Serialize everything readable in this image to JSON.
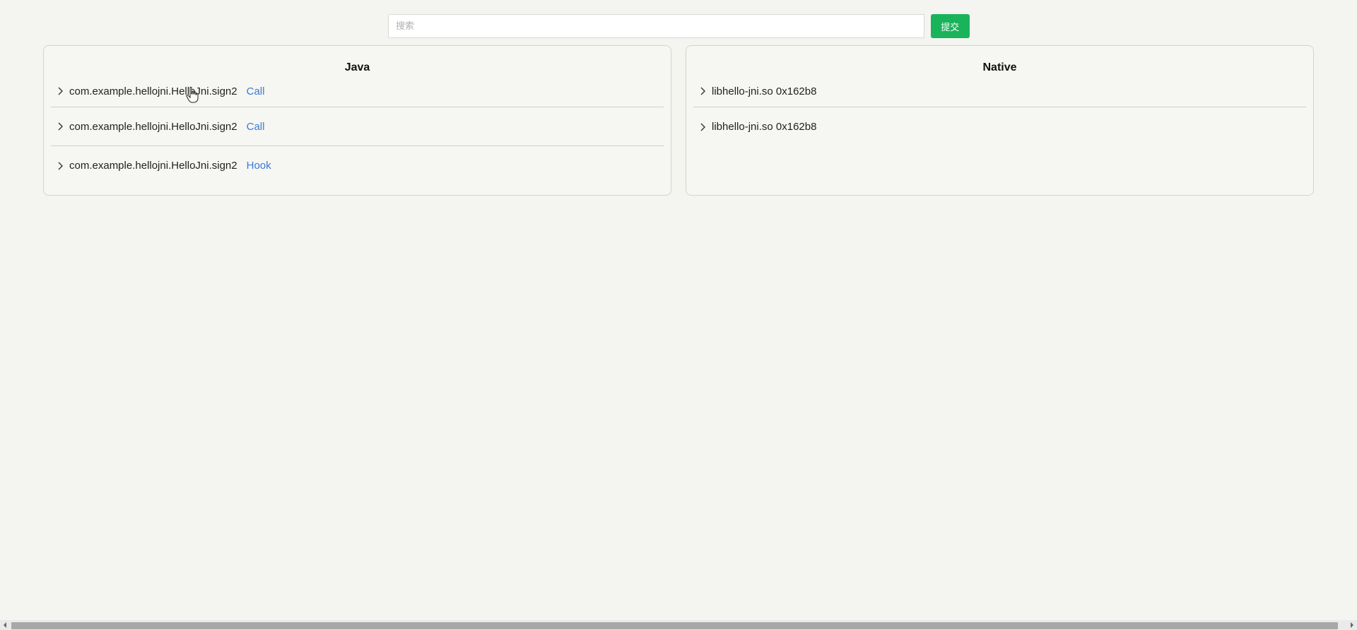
{
  "search": {
    "placeholder": "搜索",
    "value": "",
    "submit_label": "提交"
  },
  "java_panel": {
    "title": "Java",
    "items": [
      {
        "label": "com.example.hellojni.HelloJni.sign2",
        "action": "Call"
      },
      {
        "label": "com.example.hellojni.HelloJni.sign2",
        "action": "Call"
      },
      {
        "label": "com.example.hellojni.HelloJni.sign2",
        "action": "Hook"
      }
    ]
  },
  "native_panel": {
    "title": "Native",
    "items": [
      {
        "label": "libhello-jni.so 0x162b8"
      },
      {
        "label": "libhello-jni.so 0x162b8"
      }
    ]
  },
  "icons": {
    "expand": "chevron-right-icon",
    "cursor": "hand-pointer-icon",
    "scroll_left": "arrow-left-icon",
    "scroll_right": "arrow-right-icon"
  },
  "colors": {
    "accent": "#19b35a",
    "link": "#3a7bd5",
    "background": "#f4f4f0"
  }
}
